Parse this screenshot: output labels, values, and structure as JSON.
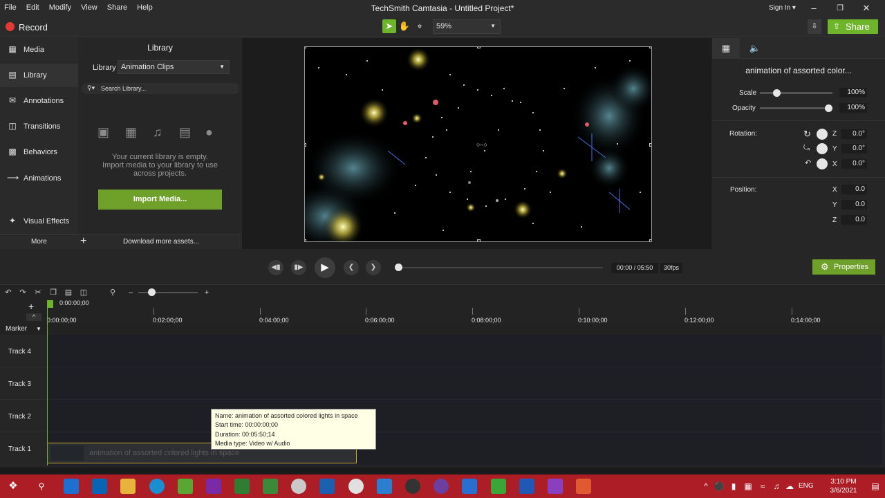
{
  "app": {
    "title": "TechSmith Camtasia - Untitled Project*",
    "menu": [
      "File",
      "Edit",
      "Modify",
      "View",
      "Share",
      "Help"
    ],
    "sign_in": "Sign In ▾"
  },
  "toolbar": {
    "record_label": "Record",
    "zoom": "59%",
    "share_label": "Share"
  },
  "nav": {
    "items": [
      "Media",
      "Library",
      "Annotations",
      "Transitions",
      "Behaviors",
      "Animations",
      "Visual Effects"
    ],
    "more_label": "More",
    "download_label": "Download more assets..."
  },
  "library": {
    "title": "Library",
    "library_label": "Library",
    "selected": "Animation Clips",
    "search_placeholder": "Search Library...",
    "empty_line1": "Your current library is empty.",
    "empty_line2": "Import media to your library to use",
    "empty_line3": "across projects.",
    "import_label": "Import Media..."
  },
  "properties": {
    "clip_name": "animation of assorted color...",
    "scale_label": "Scale",
    "scale_value": "100%",
    "scale_level": 0.2,
    "opacity_label": "Opacity",
    "opacity_value": "100%",
    "opacity_level": 1.0,
    "rotation_label": "Rotation:",
    "rotation": [
      {
        "axis": "Z",
        "value": "0.0°"
      },
      {
        "axis": "Y",
        "value": "0.0°"
      },
      {
        "axis": "X",
        "value": "0.0°"
      }
    ],
    "position_label": "Position:",
    "position": [
      {
        "axis": "X",
        "value": "0.0"
      },
      {
        "axis": "Y",
        "value": "0.0"
      },
      {
        "axis": "Z",
        "value": "0.0"
      }
    ],
    "button_label": "Properties"
  },
  "playback": {
    "time": "00:00 / 05:50",
    "fps": "30fps"
  },
  "timeline": {
    "playhead_time": "0:00:00;00",
    "ticks": [
      "0:00:00;00",
      "0:02:00;00",
      "0:04:00;00",
      "0:06:00;00",
      "0:08:00;00",
      "0:10:00;00",
      "0:12:00;00",
      "0:14:00;00"
    ],
    "marker_label": "Marker",
    "tracks": [
      "Track 4",
      "Track 3",
      "Track 2",
      "Track 1"
    ],
    "clip_label": "animation of assorted colored lights in space"
  },
  "tooltip": {
    "name": "Name: animation of assorted colored lights in space",
    "start": "Start time: 00:00:00;00",
    "duration": "Duration: 00:05:50;14",
    "type": "Media type: Video w/ Audio"
  },
  "taskbar": {
    "lang": "ENG",
    "time": "3:10 PM",
    "date": "3/6/2021"
  },
  "colors": {
    "accent_green": "#6fb52c",
    "record_red": "#e53935",
    "taskbar": "#ad1d26"
  }
}
